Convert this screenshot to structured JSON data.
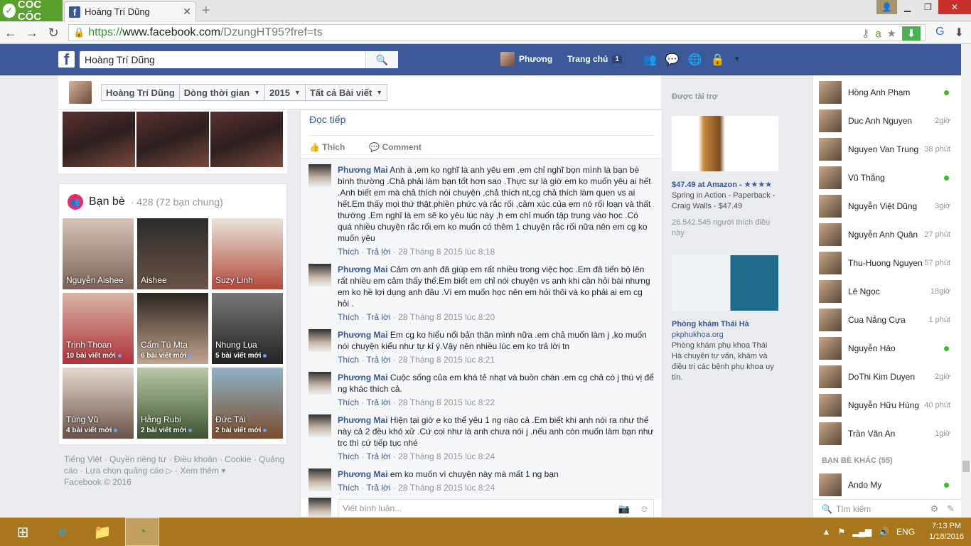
{
  "browser": {
    "brand": "CỐC CỐC",
    "tab_title": "Hoàng Trí Dũng",
    "url_https": "https://",
    "url_domain": "www.facebook.com",
    "url_path": "/DzungHT95?fref=ts"
  },
  "fb": {
    "search_value": "Hoàng Trí Dũng",
    "user_name": "Phương",
    "home_label": "Trang chủ",
    "home_count": "1"
  },
  "profile_nav": {
    "name": "Hoàng Trí Dũng",
    "timeline": "Dòng thời gian",
    "year": "2015",
    "filter": "Tất cả Bài viết"
  },
  "friends": {
    "title": "Bạn bè",
    "count": "· 428 (72 bạn chung)",
    "tiles": [
      {
        "name": "Nguyễn Aishee",
        "sub": ""
      },
      {
        "name": "Aishee",
        "sub": ""
      },
      {
        "name": "Suzy Linh",
        "sub": ""
      },
      {
        "name": "Trịnh Thoan",
        "sub": "10 bài viết mới"
      },
      {
        "name": "Cẩm Tú Mta",
        "sub": "6 bài viết mới"
      },
      {
        "name": "Nhung Lụa",
        "sub": "5 bài viết mới"
      },
      {
        "name": "Tùng Vũ",
        "sub": "4 bài viết mới"
      },
      {
        "name": "Hằng Rubi",
        "sub": "2 bài viết mới"
      },
      {
        "name": "Đức Tài",
        "sub": "2 bài viết mới"
      }
    ]
  },
  "footer": {
    "text": "Tiếng Việt · Quyền riêng tư · Điều khoản · Cookie · Quảng cáo · Lựa chọn quảng cáo ▷ · Xem thêm ▾",
    "copyright": "Facebook © 2016"
  },
  "post": {
    "read_more": "Đọc tiếp",
    "like": "Thích",
    "comment": "Comment"
  },
  "comments": [
    {
      "author": "Phương Mai",
      "text": "Anh à ,em ko nghĩ là anh yêu em .em chỉ nghĩ bọn mình là bạn bè bình thường .Chả phải làm bạn tốt hơn sao .Thực sự là giờ em ko muốn yêu ai hết .Anh biết em mà chả thích nói chuyện ,chả thích nt,cg chả thích làm quen vs ai hết.Em thấy mọi thứ thật phiền phức và rắc rối ,cảm xúc của em nó rối loạn và thất thường .Em nghĩ là em sẽ ko yêu lúc này ,h em chỉ muốn tập trung vào học .Có quá nhiều chuyện rắc rối em ko muốn có thêm 1 chuyện rắc rối nữa nên em cg ko muốn yêu",
      "like": "Thích",
      "reply": "Trả lời",
      "time": "28 Tháng 8 2015 lúc 8:18"
    },
    {
      "author": "Phương Mai",
      "text": "Cảm ơn anh đã giúp em rất nhiều trong việc học .Em đã tiến bộ lên rất nhiều em cảm thấy thế.Em biết em chỉ nói chuyện vs anh khi cần hỏi bài nhưng em ko hề lợi dụng anh đâu .Vì em muốn học nên em hỏi thôi và ko phải ai em cg hỏi .",
      "like": "Thích",
      "reply": "Trả lời",
      "time": "28 Tháng 8 2015 lúc 8:20"
    },
    {
      "author": "Phương Mai",
      "text": "Em cg ko hiểu nổi bản thân mình nữa .em chả muốn làm j ,ko muốn nói chuyện kiểu như tự kỉ ý.Vậy nên nhiều lúc em ko trả lời tn",
      "like": "Thích",
      "reply": "Trả lời",
      "time": "28 Tháng 8 2015 lúc 8:21"
    },
    {
      "author": "Phương Mai",
      "text": "Cuộc sống của em khá tẻ nhạt và buồn chán .em cg chả có j thú vị để ng khác thích cả.",
      "like": "Thích",
      "reply": "Trả lời",
      "time": "28 Tháng 8 2015 lúc 8:22"
    },
    {
      "author": "Phương Mai",
      "text": "Hiện tại giờ e ko thể yêu 1 ng nào cả .Em biết khi anh nói ra như thế này cả 2 đều khó xử .Cứ coi như là anh chưa nói j .nếu anh còn muốn làm bạn như trc thì cứ tiếp tục nhé",
      "like": "Thích",
      "reply": "Trả lời",
      "time": "28 Tháng 8 2015 lúc 8:24"
    },
    {
      "author": "Phương Mai",
      "text": "em ko muốn vì chuyện này mà mất 1 ng bạn",
      "like": "Thích",
      "reply": "Trả lời",
      "time": "28 Tháng 8 2015 lúc 8:24"
    }
  ],
  "write_placeholder": "Viết bình luận...",
  "ads": {
    "header": "Được tài trợ",
    "ad1_title": "$47.49 at Amazon - ★★★★",
    "ad1_text": "Spring in Action - Paperback - Craig Walls - $47.49",
    "ad1_likes": "26.542.545 người thích điều này",
    "ad2_title": "Phòng khám Thái Hà",
    "ad2_site": "pkphukhoa.org",
    "ad2_text": "Phòng khám phụ khoa Thái Hà chuyên tư vấn, khám và điều trị các bệnh phụ khoa uy tín."
  },
  "chat": {
    "friends": [
      {
        "name": "Hồng Anh Phạm",
        "status": "online"
      },
      {
        "name": "Duc Anh Nguyen",
        "status": "2giờ"
      },
      {
        "name": "Nguyen Van Trung",
        "status": "38 phút"
      },
      {
        "name": "Vũ Thắng",
        "status": "online"
      },
      {
        "name": "Nguyễn Việt Dũng",
        "status": "3giờ"
      },
      {
        "name": "Nguyễn Anh Quân",
        "status": "27 phút"
      },
      {
        "name": "Thu-Huong Nguyen",
        "status": "57 phút"
      },
      {
        "name": "Lê Ngọc",
        "status": "18giờ"
      },
      {
        "name": "Cua Nắng Cựa",
        "status": "1 phút"
      },
      {
        "name": "Nguyễn Hảo",
        "status": "online"
      },
      {
        "name": "DoThi Kim Duyen",
        "status": "2giờ"
      },
      {
        "name": "Nguyễn Hữu Hùng",
        "status": "40 phút"
      },
      {
        "name": "Trần Văn An",
        "status": "1giờ"
      }
    ],
    "other_header": "BẠN BÈ KHÁC (55)",
    "other": {
      "name": "Ando My",
      "status": "online"
    },
    "search": "Tìm kiếm"
  },
  "taskbar": {
    "lang": "ENG",
    "time": "7:13 PM",
    "date": "1/18/2016"
  }
}
